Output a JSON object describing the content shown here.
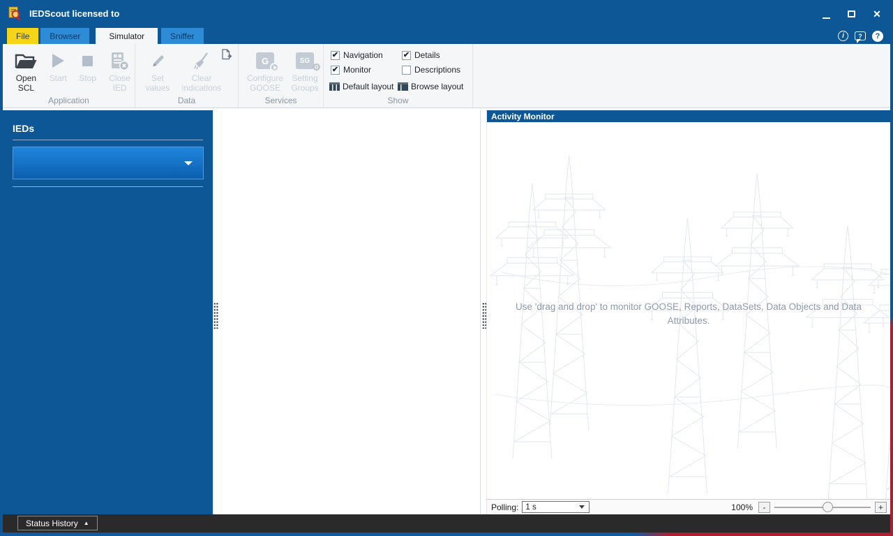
{
  "window": {
    "title": "IEDScout licensed to",
    "controls": {
      "minimize": "minimize-icon",
      "maximize": "maximize-icon",
      "close_glyph": "✕"
    }
  },
  "tabs": [
    {
      "label": "File",
      "active": false
    },
    {
      "label": "Browser",
      "active": false
    },
    {
      "label": "Simulator",
      "active": true
    },
    {
      "label": "Sniffer",
      "active": false
    }
  ],
  "help_icons": {
    "info": "i",
    "feedback": "?",
    "help": "?"
  },
  "ribbon": {
    "groups": [
      {
        "label": "Application",
        "buttons": [
          {
            "lines": [
              "Open",
              "SCL"
            ],
            "enabled": true,
            "icon": "folder-open-icon"
          },
          {
            "lines": [
              "Start",
              ""
            ],
            "enabled": false,
            "icon": "play-icon"
          },
          {
            "lines": [
              "Stop",
              ""
            ],
            "enabled": false,
            "icon": "stop-icon"
          },
          {
            "lines": [
              "Close",
              "IED"
            ],
            "enabled": false,
            "icon": "device-close-icon"
          }
        ]
      },
      {
        "label": "Data",
        "buttons": [
          {
            "lines": [
              "Set",
              "values"
            ],
            "enabled": false,
            "icon": "pencil-icon"
          },
          {
            "lines": [
              "Clear",
              "indications"
            ],
            "enabled": false,
            "icon": "broom-icon"
          }
        ],
        "corner_icon": "report-export-icon"
      },
      {
        "label": "Services",
        "buttons": [
          {
            "lines": [
              "Configure",
              "GOOSE"
            ],
            "enabled": false,
            "icon": "goose-icon",
            "icon_letter": "G"
          },
          {
            "lines": [
              "Setting",
              "Groups"
            ],
            "enabled": false,
            "icon": "setting-groups-icon",
            "icon_letter": "SG"
          }
        ]
      },
      {
        "label": "Show",
        "checkboxes": [
          {
            "label": "Navigation",
            "checked": true,
            "glyph": "✔"
          },
          {
            "label": "Monitor",
            "checked": true,
            "glyph": "✔"
          },
          {
            "label": "Details",
            "checked": true,
            "glyph": "✔"
          },
          {
            "label": "Descriptions",
            "checked": false,
            "glyph": ""
          }
        ],
        "layout_buttons": [
          {
            "label": "Default layout",
            "icon": "columns-layout-icon"
          },
          {
            "label": "Browse layout",
            "icon": "browse-layout-icon"
          }
        ]
      }
    ]
  },
  "sidebar": {
    "title": "IEDs",
    "dropdown": {
      "value": ""
    }
  },
  "activity_monitor": {
    "title": "Activity Monitor",
    "empty_message": "Use 'drag and drop' to monitor GOOSE, Reports, DataSets, Data Objects and Data Attributes.",
    "polling": {
      "label": "Polling:",
      "value": "1 s"
    },
    "zoom": {
      "value": "100%",
      "minus": "-",
      "plus": "+"
    }
  },
  "status_bar": {
    "label": "Status History",
    "collapse_glyph": "▲"
  },
  "colors": {
    "titlebar_blue": "#0d5796",
    "tab_yellow": "#f6d418",
    "tab_light_blue": "#2e8bd5",
    "ribbon_bg": "#f4f6f8",
    "sidebar_blue": "#0d5796",
    "accent_red": "#ad1f2e",
    "statusbar_dark": "#2a2a2a",
    "watermark_stroke": "#e2e7ee",
    "disabled_gray": "#c7d0da"
  }
}
